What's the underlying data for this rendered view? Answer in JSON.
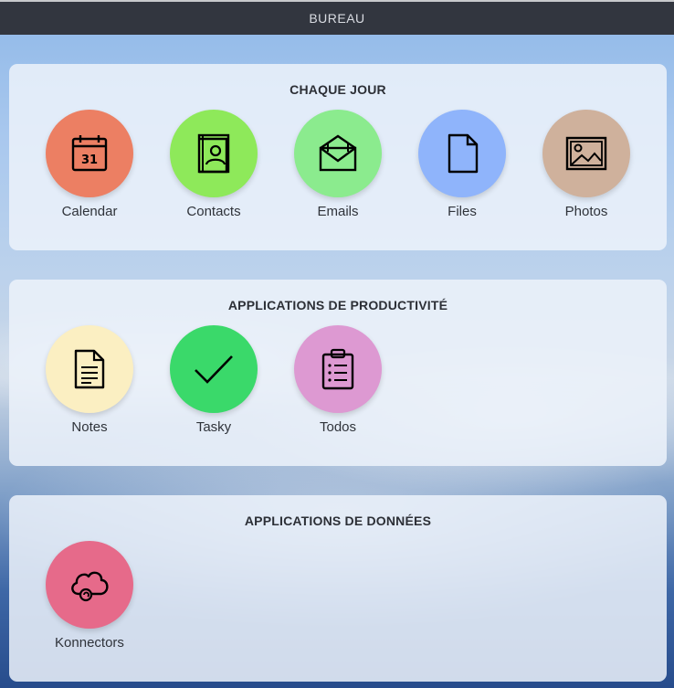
{
  "topbar": {
    "title": "BUREAU"
  },
  "sections": [
    {
      "title": "CHAQUE JOUR",
      "apps": [
        {
          "label": "Calendar",
          "icon": "calendar-icon",
          "color": "#ec7f63",
          "day": "31"
        },
        {
          "label": "Contacts",
          "icon": "contacts-book-icon",
          "color": "#8ee95a"
        },
        {
          "label": "Emails",
          "icon": "envelope-icon",
          "color": "#8beb8e"
        },
        {
          "label": "Files",
          "icon": "file-icon",
          "color": "#8fb4fb"
        },
        {
          "label": "Photos",
          "icon": "image-icon",
          "color": "#cfb19c"
        }
      ]
    },
    {
      "title": "APPLICATIONS DE PRODUCTIVITÉ",
      "apps": [
        {
          "label": "Notes",
          "icon": "note-document-icon",
          "color": "#fbefc2"
        },
        {
          "label": "Tasky",
          "icon": "checkmark-icon",
          "color": "#3ad96a"
        },
        {
          "label": "Todos",
          "icon": "clipboard-list-icon",
          "color": "#dd99d2"
        }
      ]
    },
    {
      "title": "APPLICATIONS DE DONNÉES",
      "apps": [
        {
          "label": "Konnectors",
          "icon": "cloud-sync-icon",
          "color": "#e66a8a"
        }
      ]
    }
  ]
}
